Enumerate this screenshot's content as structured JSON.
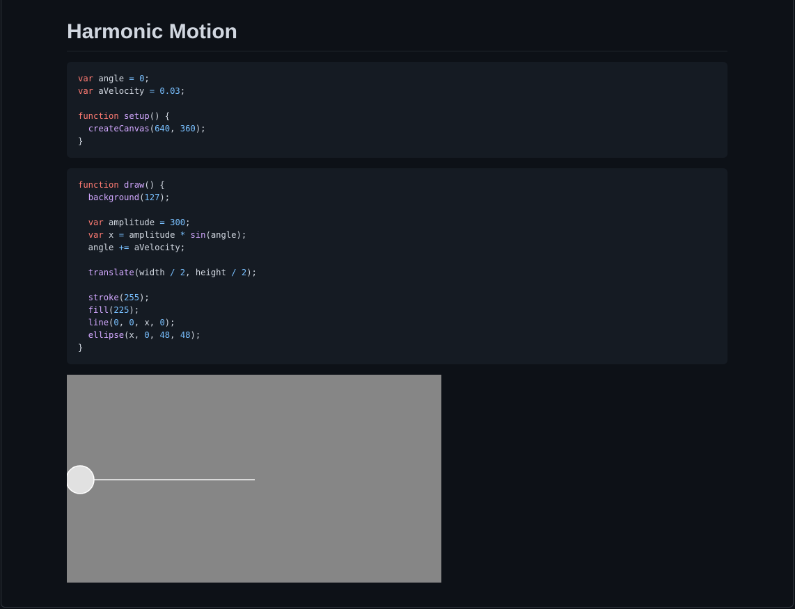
{
  "page": {
    "title": "Harmonic Motion"
  },
  "code_blocks": [
    {
      "lines": [
        [
          [
            "k",
            "var"
          ],
          [
            "p",
            " angle "
          ],
          [
            "o",
            "="
          ],
          [
            "p",
            " "
          ],
          [
            "n",
            "0"
          ],
          [
            "p",
            ";"
          ]
        ],
        [
          [
            "k",
            "var"
          ],
          [
            "p",
            " aVelocity "
          ],
          [
            "o",
            "="
          ],
          [
            "p",
            " "
          ],
          [
            "n",
            "0.03"
          ],
          [
            "p",
            ";"
          ]
        ],
        [],
        [
          [
            "k",
            "function"
          ],
          [
            "p",
            " "
          ],
          [
            "f",
            "setup"
          ],
          [
            "p",
            "() {"
          ]
        ],
        [
          [
            "p",
            "  "
          ],
          [
            "f",
            "createCanvas"
          ],
          [
            "p",
            "("
          ],
          [
            "n",
            "640"
          ],
          [
            "p",
            ", "
          ],
          [
            "n",
            "360"
          ],
          [
            "p",
            ");"
          ]
        ],
        [
          [
            "p",
            "}"
          ]
        ]
      ]
    },
    {
      "lines": [
        [
          [
            "k",
            "function"
          ],
          [
            "p",
            " "
          ],
          [
            "f",
            "draw"
          ],
          [
            "p",
            "() {"
          ]
        ],
        [
          [
            "p",
            "  "
          ],
          [
            "f",
            "background"
          ],
          [
            "p",
            "("
          ],
          [
            "n",
            "127"
          ],
          [
            "p",
            ");"
          ]
        ],
        [],
        [
          [
            "p",
            "  "
          ],
          [
            "k",
            "var"
          ],
          [
            "p",
            " amplitude "
          ],
          [
            "o",
            "="
          ],
          [
            "p",
            " "
          ],
          [
            "n",
            "300"
          ],
          [
            "p",
            ";"
          ]
        ],
        [
          [
            "p",
            "  "
          ],
          [
            "k",
            "var"
          ],
          [
            "p",
            " x "
          ],
          [
            "o",
            "="
          ],
          [
            "p",
            " amplitude "
          ],
          [
            "o",
            "*"
          ],
          [
            "p",
            " "
          ],
          [
            "f",
            "sin"
          ],
          [
            "p",
            "(angle);"
          ]
        ],
        [
          [
            "p",
            "  angle "
          ],
          [
            "o",
            "+="
          ],
          [
            "p",
            " aVelocity;"
          ]
        ],
        [],
        [
          [
            "p",
            "  "
          ],
          [
            "f",
            "translate"
          ],
          [
            "p",
            "(width "
          ],
          [
            "o",
            "/"
          ],
          [
            "p",
            " "
          ],
          [
            "n",
            "2"
          ],
          [
            "p",
            ", height "
          ],
          [
            "o",
            "/"
          ],
          [
            "p",
            " "
          ],
          [
            "n",
            "2"
          ],
          [
            "p",
            ");"
          ]
        ],
        [],
        [
          [
            "p",
            "  "
          ],
          [
            "f",
            "stroke"
          ],
          [
            "p",
            "("
          ],
          [
            "n",
            "255"
          ],
          [
            "p",
            ");"
          ]
        ],
        [
          [
            "p",
            "  "
          ],
          [
            "f",
            "fill"
          ],
          [
            "p",
            "("
          ],
          [
            "n",
            "225"
          ],
          [
            "p",
            ");"
          ]
        ],
        [
          [
            "p",
            "  "
          ],
          [
            "f",
            "line"
          ],
          [
            "p",
            "("
          ],
          [
            "n",
            "0"
          ],
          [
            "p",
            ", "
          ],
          [
            "n",
            "0"
          ],
          [
            "p",
            ", x, "
          ],
          [
            "n",
            "0"
          ],
          [
            "p",
            ");"
          ]
        ],
        [
          [
            "p",
            "  "
          ],
          [
            "f",
            "ellipse"
          ],
          [
            "p",
            "(x, "
          ],
          [
            "n",
            "0"
          ],
          [
            "p",
            ", "
          ],
          [
            "n",
            "48"
          ],
          [
            "p",
            ", "
          ],
          [
            "n",
            "48"
          ],
          [
            "p",
            ");"
          ]
        ],
        [
          [
            "p",
            "}"
          ]
        ]
      ]
    }
  ],
  "sketch": {
    "background": "#868686",
    "line_color": "#d9d9d9",
    "ball_fill": "#e1e1e1",
    "ball_stroke": "#ffffff"
  },
  "colors": {
    "page_bg": "#0d1117",
    "code_bg": "#151b23",
    "keyword": "#ff7b72",
    "function": "#d2a8ff",
    "number": "#79c0ff",
    "text": "#d1d7e0"
  }
}
